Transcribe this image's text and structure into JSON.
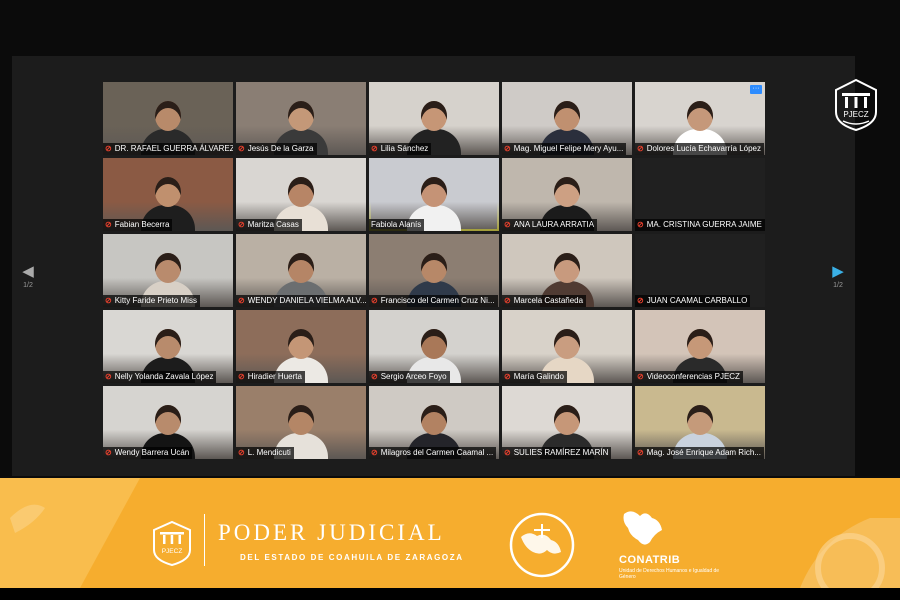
{
  "meeting": {
    "page_indicator_left": "1/2",
    "page_indicator_right": "1/2",
    "participants": [
      {
        "name": "DR. RAFAEL GUERRA ÁLVAREZ",
        "muted": true,
        "bg": "#6a6257",
        "skin": "#b88a6a",
        "shirt": "#2a2a2a"
      },
      {
        "name": "Jesús De la Garza",
        "muted": true,
        "bg": "#8a7e74",
        "skin": "#c49878",
        "shirt": "#3a3a3a"
      },
      {
        "name": "Lilia Sánchez",
        "muted": true,
        "bg": "#d6d2cc",
        "skin": "#c69676",
        "shirt": "#222222"
      },
      {
        "name": "Mag. Miguel Felipe Mery Ayu...",
        "muted": true,
        "bg": "#cfcbc7",
        "skin": "#c09070",
        "shirt": "#2b2f3c"
      },
      {
        "name": "Dolores Lucía Echavarría López",
        "muted": true,
        "bg": "#d8d4cf",
        "skin": "#c5987a",
        "shirt": "#ffffff",
        "has_more": true
      },
      {
        "name": "Fabian Becerra",
        "muted": true,
        "bg": "#8b5a44",
        "skin": "#c0906e",
        "shirt": "#1e1e1e"
      },
      {
        "name": "Maritza Casas",
        "muted": true,
        "bg": "#d9d6d2",
        "skin": "#b78566",
        "shirt": "#e8e0d6"
      },
      {
        "name": "Fabiola Alanís",
        "muted": false,
        "speaking": true,
        "bg": "#c9cbd0",
        "skin": "#c59376",
        "shirt": "#f1f1f1"
      },
      {
        "name": "ANA LAURA ARRATIA",
        "muted": true,
        "bg": "#bfb7ad",
        "skin": "#cda083",
        "shirt": "#1b1b1b"
      },
      {
        "name": "MA. CRISTINA GUERRA JAIME",
        "muted": true,
        "empty": true
      },
      {
        "name": "Kitty Faride Prieto Miss",
        "muted": true,
        "bg": "#c7c6c2",
        "skin": "#b98b6d",
        "shirt": "#d8d0c6"
      },
      {
        "name": "WENDY DANIELA VIELMA ALV...",
        "muted": true,
        "bg": "#bab0a4",
        "skin": "#b58566",
        "shirt": "#6b6e70"
      },
      {
        "name": "Francisco del Carmen Cruz Ni...",
        "muted": true,
        "bg": "#8c7e72",
        "skin": "#b78868",
        "shirt": "#2f3a4a"
      },
      {
        "name": "Marcela Castañeda",
        "muted": true,
        "bg": "#cfc7bd",
        "skin": "#c89a7e",
        "shirt": "#503b33"
      },
      {
        "name": "JUAN CAAMAL CARBALLO",
        "muted": true,
        "empty": true
      },
      {
        "name": "Nelly Yolanda Zavala López",
        "muted": true,
        "bg": "#d9d7d3",
        "skin": "#b88b6c",
        "shirt": "#1c1c1c"
      },
      {
        "name": "Hiradier Huerta",
        "muted": true,
        "bg": "#8d6d5a",
        "skin": "#c49676",
        "shirt": "#ece9e4"
      },
      {
        "name": "Sergio Arceo Foyo",
        "muted": true,
        "bg": "#d4d2ce",
        "skin": "#a97858",
        "shirt": "#e8e8e8"
      },
      {
        "name": "María Galindo",
        "muted": true,
        "bg": "#d8d2c9",
        "skin": "#c99d80",
        "shirt": "#e6d7c5"
      },
      {
        "name": "Videoconferencias PJECZ",
        "muted": true,
        "bg": "#d3c4b8",
        "skin": "#c69878",
        "shirt": "#2a2a2a"
      },
      {
        "name": "Wendy Barrera Ucán",
        "muted": true,
        "bg": "#d6d4d0",
        "skin": "#b88b6c",
        "shirt": "#141414"
      },
      {
        "name": "L. Mendicuti",
        "muted": true,
        "bg": "#9a7f6a",
        "skin": "#b48666",
        "shirt": "#e6e1da"
      },
      {
        "name": "Milagros del Carmen Caamal ...",
        "muted": true,
        "bg": "#cfcac4",
        "skin": "#b28262",
        "shirt": "#24242a"
      },
      {
        "name": "SULIES RAMÍREZ MARÍN",
        "muted": true,
        "bg": "#ddd9d4",
        "skin": "#c69778",
        "shirt": "#2b2b2b"
      },
      {
        "name": "Mag. José Enrique Adam Rich...",
        "muted": true,
        "bg": "#c9b98f",
        "skin": "#c59a7a",
        "shirt": "#c9d2de"
      }
    ]
  },
  "corner_logo": {
    "text": "PJECZ"
  },
  "banner": {
    "org_name": "PODER JUDICIAL",
    "org_subtitle": "DEL ESTADO DE COAHUILA DE ZARAGOZA",
    "logo_small_text": "PJECZ",
    "partner_name": "CONATRIB",
    "partner_subtitle": "Unidad de Derechos Humanos e Igualdad de Género",
    "color": "#f6ad2e"
  },
  "icons": {
    "mic_muted": "muted-mic-icon",
    "prev": "chevron-left-icon",
    "next": "chevron-right-icon"
  }
}
